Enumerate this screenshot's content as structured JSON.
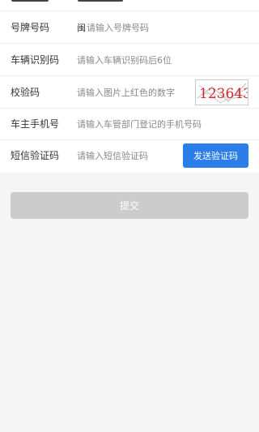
{
  "form": {
    "plate": {
      "label": "号牌号码",
      "prefix": "闽",
      "placeholder": "请输入号牌号码"
    },
    "vin": {
      "label": "车辆识别码",
      "placeholder": "请输入车辆识别码后6位"
    },
    "verify": {
      "label": "校验码",
      "placeholder": "请输入图片上红色的数字",
      "captcha_text": "123643"
    },
    "phone": {
      "label": "车主手机号",
      "placeholder": "请输入车管部门登记的手机号码"
    },
    "sms": {
      "label": "短信验证码",
      "placeholder": "请输入短信验证码",
      "button_label": "发送验证码"
    }
  },
  "submit": {
    "label": "提交"
  },
  "colors": {
    "primary": "#2b7de9",
    "disabled": "#cccccc",
    "captcha_red": "#d0282e"
  }
}
